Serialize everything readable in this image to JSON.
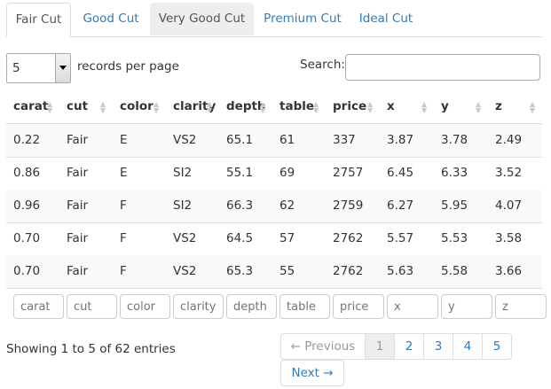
{
  "tabs": [
    "Fair Cut",
    "Good Cut",
    "Very Good Cut",
    "Premium Cut",
    "Ideal Cut"
  ],
  "length": {
    "value": "5",
    "label": "records per page"
  },
  "search": {
    "label": "Search:",
    "value": ""
  },
  "table": {
    "columns": [
      "carat",
      "cut",
      "color",
      "clarity",
      "depth",
      "table",
      "price",
      "x",
      "y",
      "z"
    ],
    "rows": [
      [
        "0.22",
        "Fair",
        "E",
        "VS2",
        "65.1",
        "61",
        "337",
        "3.87",
        "3.78",
        "2.49"
      ],
      [
        "0.86",
        "Fair",
        "E",
        "SI2",
        "55.1",
        "69",
        "2757",
        "6.45",
        "6.33",
        "3.52"
      ],
      [
        "0.96",
        "Fair",
        "F",
        "SI2",
        "66.3",
        "62",
        "2759",
        "6.27",
        "5.95",
        "4.07"
      ],
      [
        "0.70",
        "Fair",
        "F",
        "VS2",
        "64.5",
        "57",
        "2762",
        "5.57",
        "5.53",
        "3.58"
      ],
      [
        "0.70",
        "Fair",
        "F",
        "VS2",
        "65.3",
        "55",
        "2762",
        "5.63",
        "5.58",
        "3.66"
      ]
    ],
    "filter_placeholders": [
      "carat",
      "cut",
      "color",
      "clarity",
      "depth",
      "table",
      "price",
      "x",
      "y",
      "z"
    ]
  },
  "info": "Showing 1 to 5 of 62 entries",
  "pagination": {
    "previous": "← Previous",
    "next": "Next →",
    "pages": [
      "1",
      "2",
      "3",
      "4",
      "5"
    ],
    "current": "1"
  },
  "colors": {
    "link": "#337ab7",
    "border": "#dddddd",
    "stripe": "#f9f9f9",
    "hover_tab": "#eeeeee"
  }
}
